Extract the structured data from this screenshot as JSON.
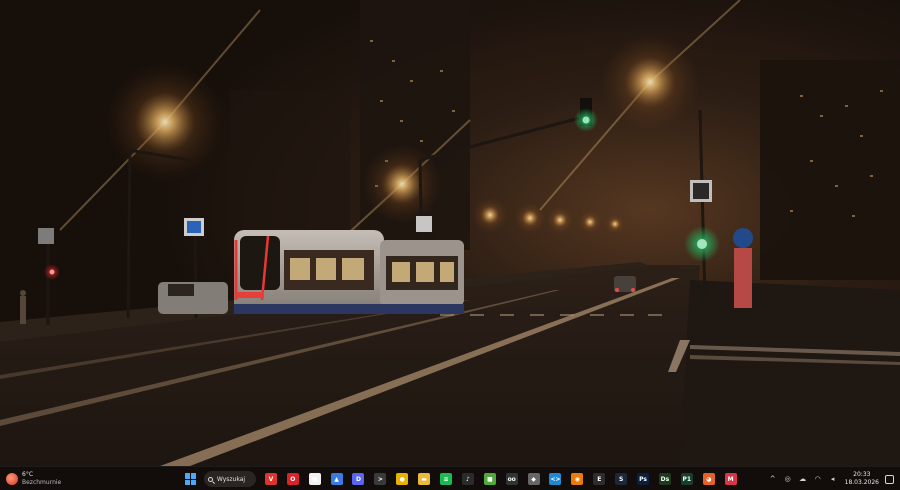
{
  "weather": {
    "temperature": "6°C",
    "condition": "Bezchmurnie",
    "icon": "weather-icon"
  },
  "taskbar": {
    "search_label": "Wyszukaj",
    "apps": [
      {
        "name": "vivaldi-icon",
        "color": "#e0332e",
        "glyph": "V"
      },
      {
        "name": "opera-icon",
        "color": "#d8232a",
        "glyph": "O"
      },
      {
        "name": "calendar-icon",
        "color": "#f1f1f1",
        "glyph": "▦"
      },
      {
        "name": "photos-icon",
        "color": "#3b7be0",
        "glyph": "▲"
      },
      {
        "name": "discord-icon",
        "color": "#5865f2",
        "glyph": "D"
      },
      {
        "name": "terminal-icon",
        "color": "#3a3a3a",
        "glyph": ">"
      },
      {
        "name": "chrome-icon",
        "color": "#e8b300",
        "glyph": "●"
      },
      {
        "name": "file-explorer-icon",
        "color": "#e8b93a",
        "glyph": "▬"
      },
      {
        "name": "spotify-icon",
        "color": "#1db954",
        "glyph": "≡"
      },
      {
        "name": "audio-icon",
        "color": "#2b2b2b",
        "glyph": "♪"
      },
      {
        "name": "minecraft-icon",
        "color": "#4fa93b",
        "glyph": "■"
      },
      {
        "name": "vr-icon",
        "color": "#333333",
        "glyph": "oo"
      },
      {
        "name": "app-cube-icon",
        "color": "#666666",
        "glyph": "◆"
      },
      {
        "name": "vscode-icon",
        "color": "#1f8ad2",
        "glyph": "<>"
      },
      {
        "name": "blender-icon",
        "color": "#e87d0d",
        "glyph": "◉"
      },
      {
        "name": "epic-games-icon",
        "color": "#2d2d2d",
        "glyph": "E"
      },
      {
        "name": "steam-icon",
        "color": "#1b2838",
        "glyph": "S"
      },
      {
        "name": "photoshop-icon",
        "color": "#0a1f3b",
        "glyph": "Ps"
      },
      {
        "name": "davinci-icon",
        "color": "#1d3a1d",
        "glyph": "Ds"
      },
      {
        "name": "pycharm-icon",
        "color": "#16402a",
        "glyph": "P1"
      },
      {
        "name": "firefox-icon",
        "color": "#e3622b",
        "glyph": "◕"
      },
      {
        "name": "app-red-icon",
        "color": "#d8344a",
        "glyph": "M"
      }
    ]
  },
  "tray": {
    "icons": [
      "chevron-up-icon",
      "network-app-icon",
      "cloud-icon",
      "wifi-icon",
      "volume-icon"
    ],
    "time": "20:33",
    "date": "18.03.2026"
  }
}
